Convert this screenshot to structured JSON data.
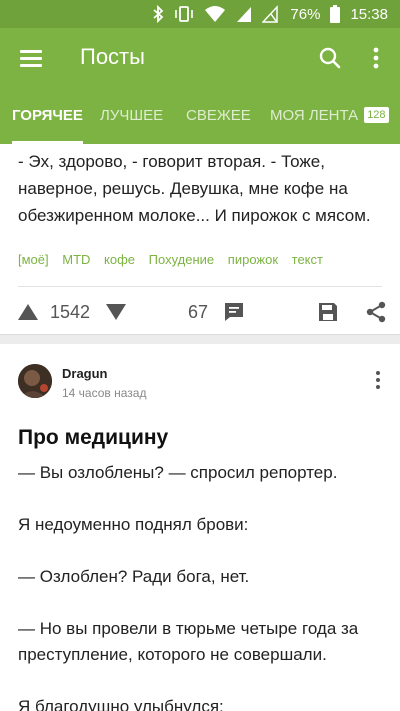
{
  "status_bar": {
    "battery_percent": "76%",
    "time": "15:38",
    "icons": [
      "bluetooth-icon",
      "vibrate-icon",
      "wifi-icon",
      "signal-icon",
      "no-sim-signal-icon",
      "battery-icon"
    ]
  },
  "app_bar": {
    "title": "Посты",
    "icons": [
      "menu-icon",
      "search-icon",
      "more-vertical-icon"
    ]
  },
  "tabs": [
    {
      "label": "ГОРЯЧЕЕ",
      "active": true
    },
    {
      "label": "ЛУЧШЕЕ",
      "active": false
    },
    {
      "label": "СВЕЖЕЕ",
      "active": false
    },
    {
      "label": "МОЯ ЛЕНТА",
      "active": false,
      "badge": "128"
    }
  ],
  "post1": {
    "text": "- Эх, здорово, - говорит вторая. - Тоже, наверное, решусь. Девушка, мне кофе на обезжиренном молоке... И пирожок с мясом.",
    "tags": [
      "[моё]",
      "MTD",
      "кофе",
      "Похудение",
      "пирожок",
      "текст"
    ],
    "rating": "1542",
    "comments": "67"
  },
  "post2": {
    "author": "Dragun",
    "time": "14 часов назад",
    "title": "Про медицину",
    "paragraphs": [
      "— Вы озлоблены? — спросил репортер.",
      "Я недоуменно поднял брови:",
      "— Озлоблен? Ради бога, нет.",
      "— Но вы провели в тюрьме четыре года за преступление, которого не совершали.",
      "Я благодушно улыбнулся:"
    ]
  },
  "colors": {
    "status_bar": "#6fa23a",
    "app_bar": "#7cb342",
    "tag_text": "#7cb342",
    "icon_gray": "#555555"
  }
}
